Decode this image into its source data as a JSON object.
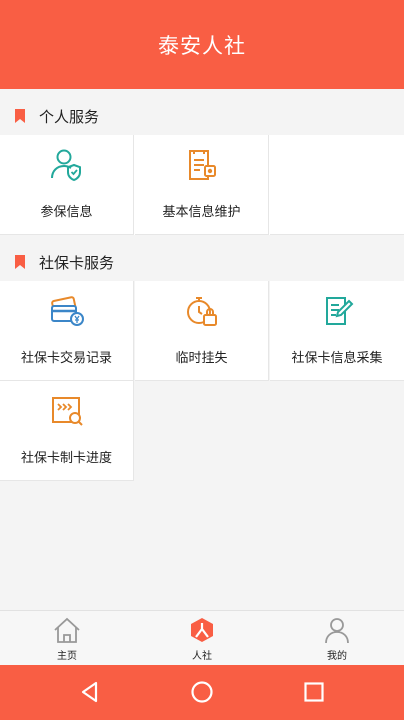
{
  "header": {
    "title": "泰安人社"
  },
  "sections": [
    {
      "title": "个人服务",
      "items": [
        {
          "label": "参保信息",
          "icon": "user-shield-icon"
        },
        {
          "label": "基本信息维护",
          "icon": "document-stamp-icon"
        }
      ]
    },
    {
      "title": "社保卡服务",
      "items": [
        {
          "label": "社保卡交易记录",
          "icon": "card-transaction-icon"
        },
        {
          "label": "临时挂失",
          "icon": "timer-lock-icon"
        },
        {
          "label": "社保卡信息采集",
          "icon": "clipboard-edit-icon"
        },
        {
          "label": "社保卡制卡进度",
          "icon": "card-progress-search-icon"
        }
      ]
    }
  ],
  "tabbar": {
    "tabs": [
      {
        "label": "主页",
        "icon": "home-icon"
      },
      {
        "label": "人社",
        "icon": "renshe-logo-icon",
        "active": true
      },
      {
        "label": "我的",
        "icon": "profile-icon"
      }
    ]
  },
  "colors": {
    "accent": "#f95e44",
    "teal": "#22a89b",
    "orange": "#e8892a",
    "blue": "#3b86c8"
  }
}
